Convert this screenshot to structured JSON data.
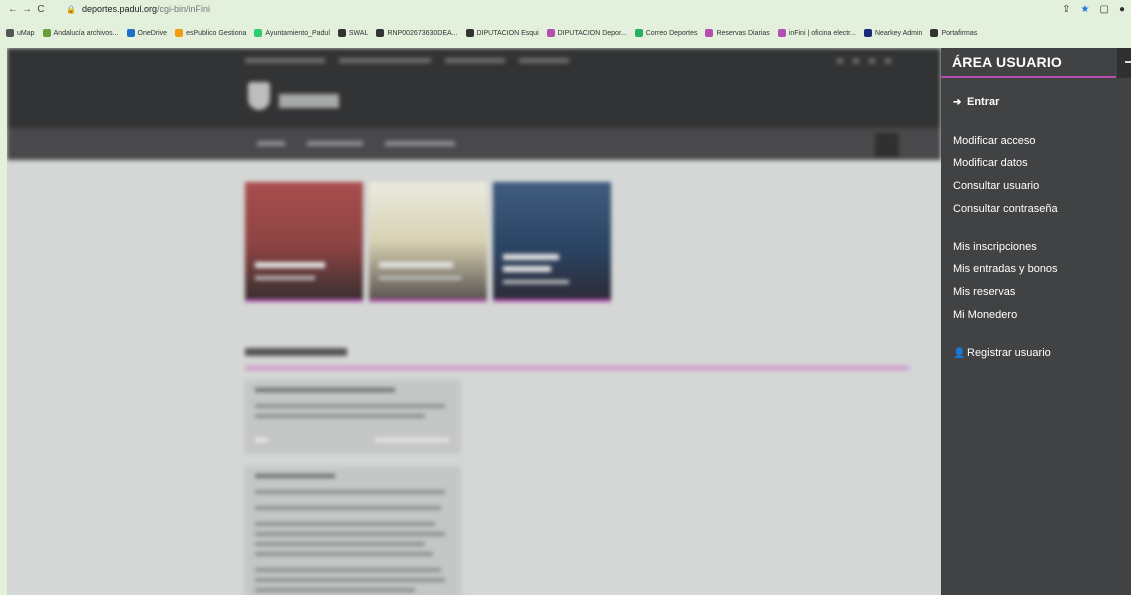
{
  "browser": {
    "url_host": "deportes.padul.org",
    "url_path": "/cgi-bin/inFini",
    "bookmarks": [
      {
        "label": "uMap",
        "color": "#555555"
      },
      {
        "label": "Andalucía archivos...",
        "color": "#6b9c3a"
      },
      {
        "label": "OneDrive",
        "color": "#1e6fc9"
      },
      {
        "label": "esPublico Gestiona",
        "color": "#f39c12"
      },
      {
        "label": "Ayuntamiento_Padul",
        "color": "#2ecc71"
      },
      {
        "label": "SWAL",
        "color": "#333333"
      },
      {
        "label": "RNP002673630DEA...",
        "color": "#333333"
      },
      {
        "label": "DIPUTACION Esqui",
        "color": "#333333"
      },
      {
        "label": "DIPUTACION Depor...",
        "color": "#b24fb0"
      },
      {
        "label": "Correo Deportes",
        "color": "#27ae60"
      },
      {
        "label": "Reservas Diarias",
        "color": "#b24fb0"
      },
      {
        "label": "inFini | oficina electr...",
        "color": "#b24fb0"
      },
      {
        "label": "Nearkey Admin",
        "color": "#1b2a7a"
      },
      {
        "label": "Portafirmas",
        "color": "#333333"
      }
    ]
  },
  "panel": {
    "title": "ÁREA USUARIO",
    "login": "Entrar",
    "items_access": [
      "Modificar acceso",
      "Modificar datos",
      "Consultar usuario",
      "Consultar contraseña"
    ],
    "items_activity": [
      "Mis inscripciones",
      "Mis entradas y bonos",
      "Mis reservas",
      "Mi Monedero"
    ],
    "register": "Registrar usuario"
  },
  "colors": {
    "accent": "#b24fb0",
    "panel_bg": "#414243",
    "page_bg": "#e3f0dc"
  }
}
